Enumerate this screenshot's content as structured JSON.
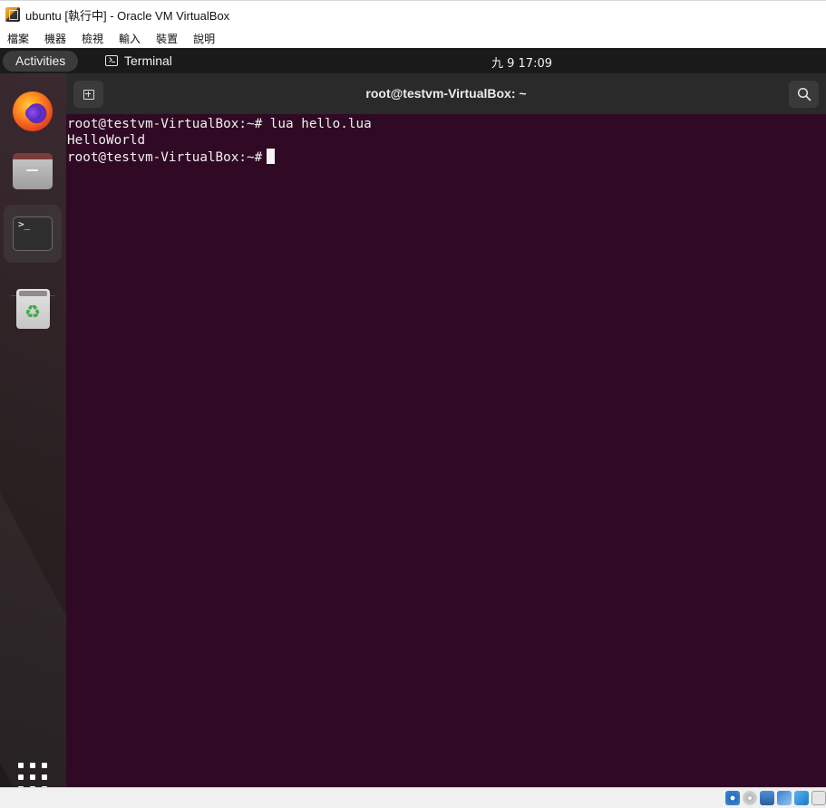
{
  "host_window": {
    "title": "ubuntu [執行中] - Oracle VM VirtualBox",
    "menu": [
      "檔案",
      "機器",
      "檢視",
      "輸入",
      "裝置",
      "說明"
    ]
  },
  "guest_topbar": {
    "activities_label": "Activities",
    "app_menu_label": "Terminal",
    "clock": "九 9  17:09"
  },
  "dock": {
    "items": [
      {
        "name": "Firefox",
        "icon": "firefox-icon"
      },
      {
        "name": "Files",
        "icon": "files-icon"
      },
      {
        "name": "Terminal",
        "icon": "terminal-icon",
        "running": true,
        "glyph": ">_"
      },
      {
        "name": "Trash",
        "icon": "trash-icon",
        "glyph": "♻"
      }
    ],
    "show_apps_icon": "grid-icon"
  },
  "terminal": {
    "title": "root@testvm-VirtualBox: ~",
    "lines": [
      "root@testvm-VirtualBox:~# lua hello.lua",
      "HelloWorld",
      "root@testvm-VirtualBox:~#"
    ]
  },
  "colors": {
    "terminal_bg": "#300a24",
    "accent": "#e95420",
    "topbar_bg": "#1a1a1a",
    "header_bg": "#2a2a2a"
  }
}
